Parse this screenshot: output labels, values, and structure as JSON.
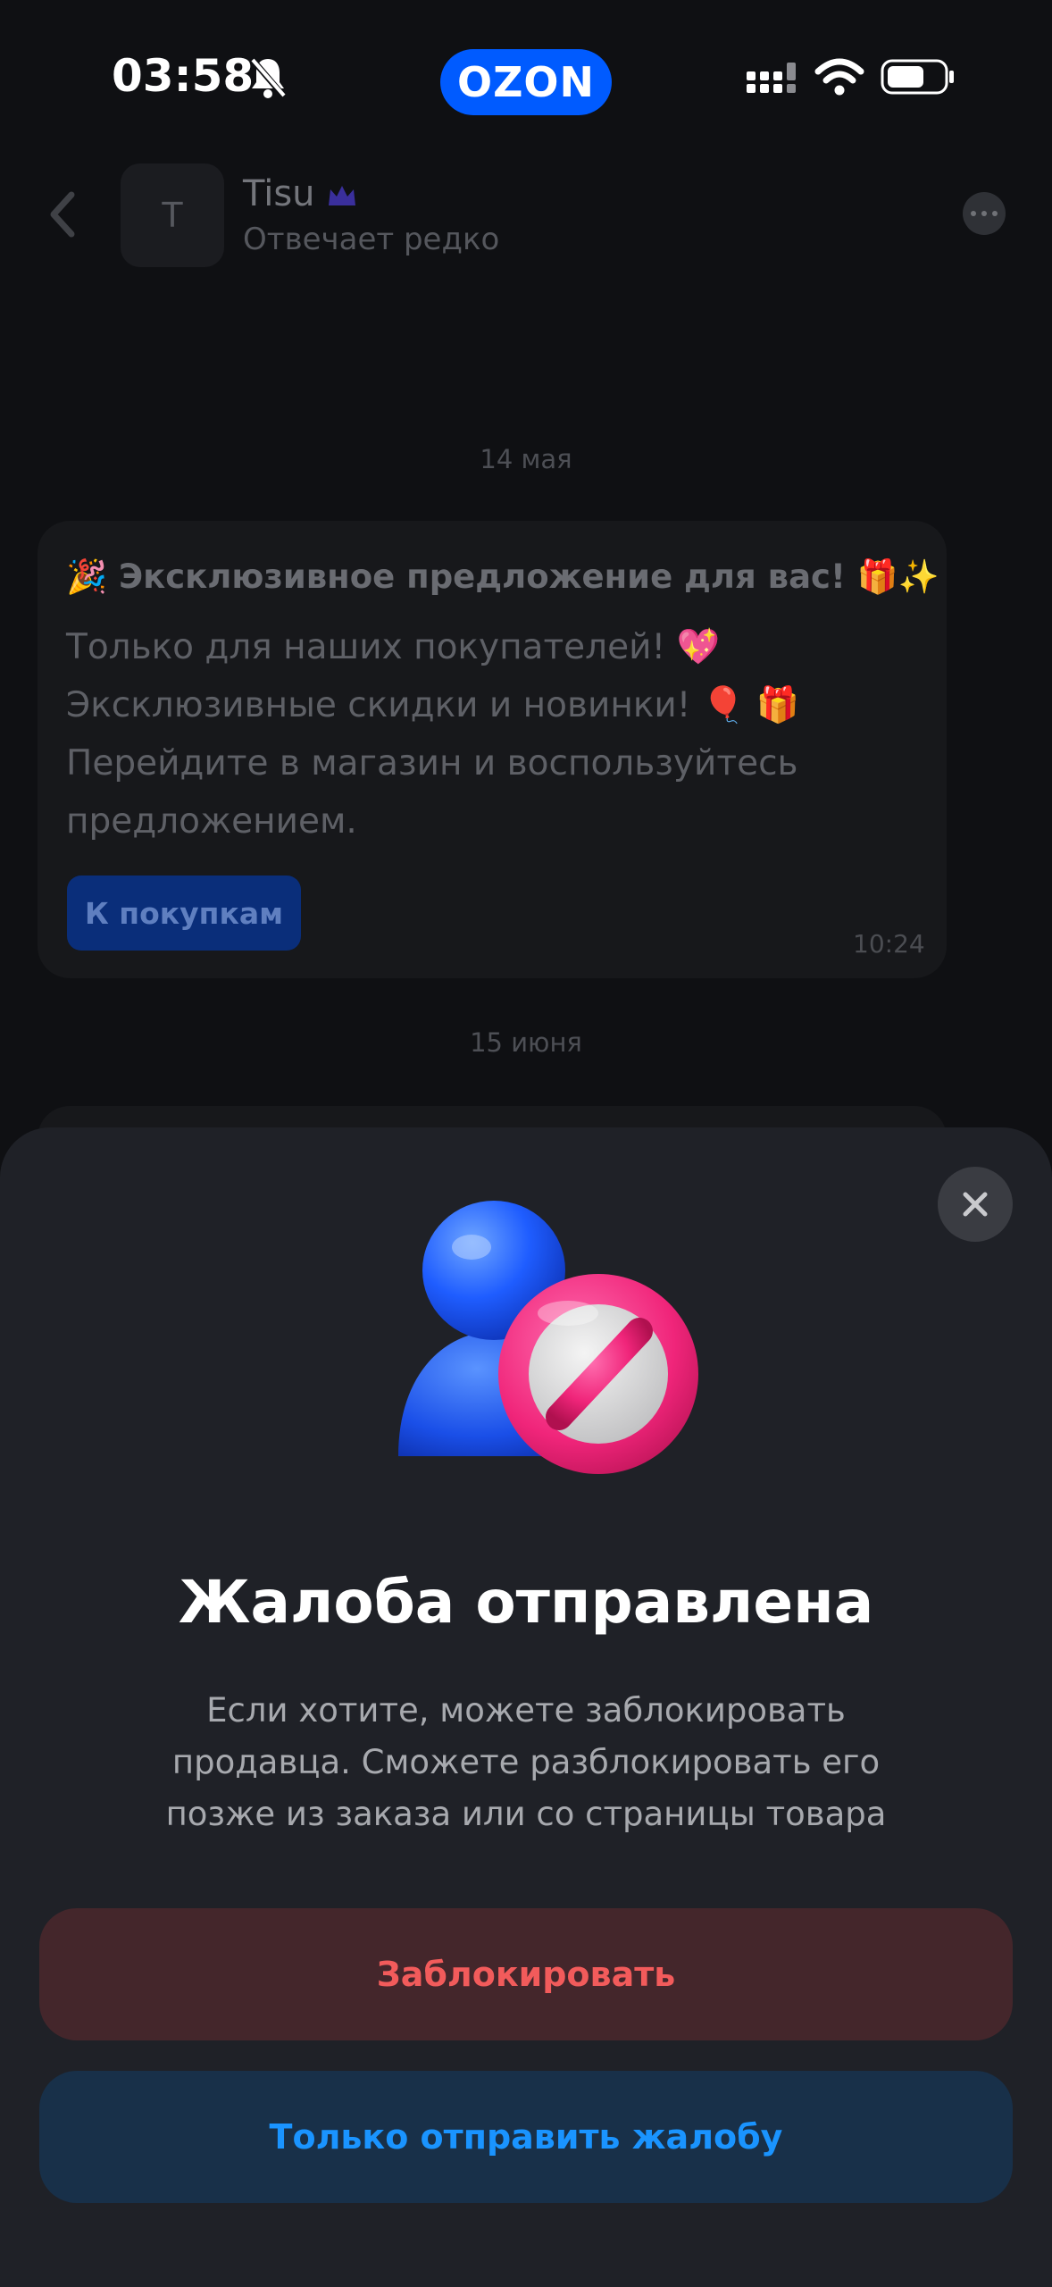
{
  "status_bar": {
    "time": "03:58",
    "brand_label": "OZON",
    "icons": [
      "bell-off-icon",
      "signal-icon",
      "wifi-icon",
      "battery-icon"
    ]
  },
  "chat_header": {
    "back_icon": "chevron-left-icon",
    "avatar_letter": "T",
    "seller_name": "Tisu",
    "seller_badge_icon": "crown-icon",
    "seller_status": "Отвечает редко",
    "menu_icon": "more-icon"
  },
  "messages": {
    "date_1": "14 мая",
    "bubble": {
      "title": "🎉 Эксклюзивное предложение для вас! 🎁✨",
      "lines": [
        "Только для наших покупателей! 💖",
        "Эксклюзивные скидки и новинки! 🎈 🎁",
        "Перейдите в магазин и воспользуйтесь",
        "предложением."
      ],
      "button_label": "К покупкам",
      "time": "10:24"
    },
    "date_2": "15 июня"
  },
  "sheet": {
    "close_icon": "close-icon",
    "illustration": "blocked-user-icon",
    "title": "Жалоба отправлена",
    "description_lines": [
      "Если хотите, можете заблокировать",
      "продавца. Сможете разблокировать его",
      "позже из заказа или со страницы товара"
    ],
    "block_button": "Заблокировать",
    "report_only_button": "Только отправить жалобу"
  },
  "colors": {
    "brand": "#005bff",
    "danger_text": "#f25b5b",
    "danger_bg": "#44262b",
    "primary_text": "#1a94ff",
    "primary_bg": "#183049",
    "sheet_bg": "#1f2127"
  }
}
